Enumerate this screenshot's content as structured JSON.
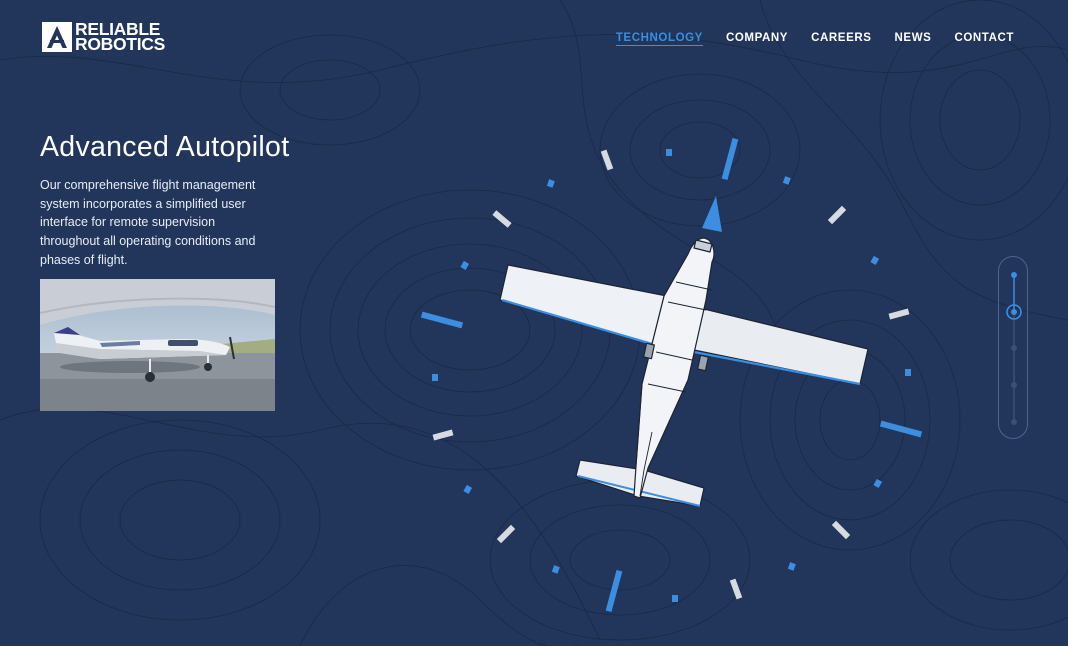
{
  "brand": {
    "line1": "RELIABLE",
    "line2": "ROBOTICS"
  },
  "nav": {
    "items": [
      {
        "label": "TECHNOLOGY",
        "active": true
      },
      {
        "label": "COMPANY",
        "active": false
      },
      {
        "label": "CAREERS",
        "active": false
      },
      {
        "label": "NEWS",
        "active": false
      },
      {
        "label": "CONTACT",
        "active": false
      }
    ]
  },
  "hero": {
    "title": "Advanced Autopilot",
    "description": "Our comprehensive flight management system incorporates a simplified user interface for remote supervision throughout all operating conditions and phases of flight."
  },
  "slider": {
    "steps": 5,
    "active_step": 2
  },
  "colors": {
    "background": "#22355a",
    "accent": "#3b8ee0",
    "tick_light": "#d6dbe2"
  },
  "icons": {
    "logo": "reliable-robotics-logo-icon",
    "aircraft": "airplane-top-view-icon"
  }
}
